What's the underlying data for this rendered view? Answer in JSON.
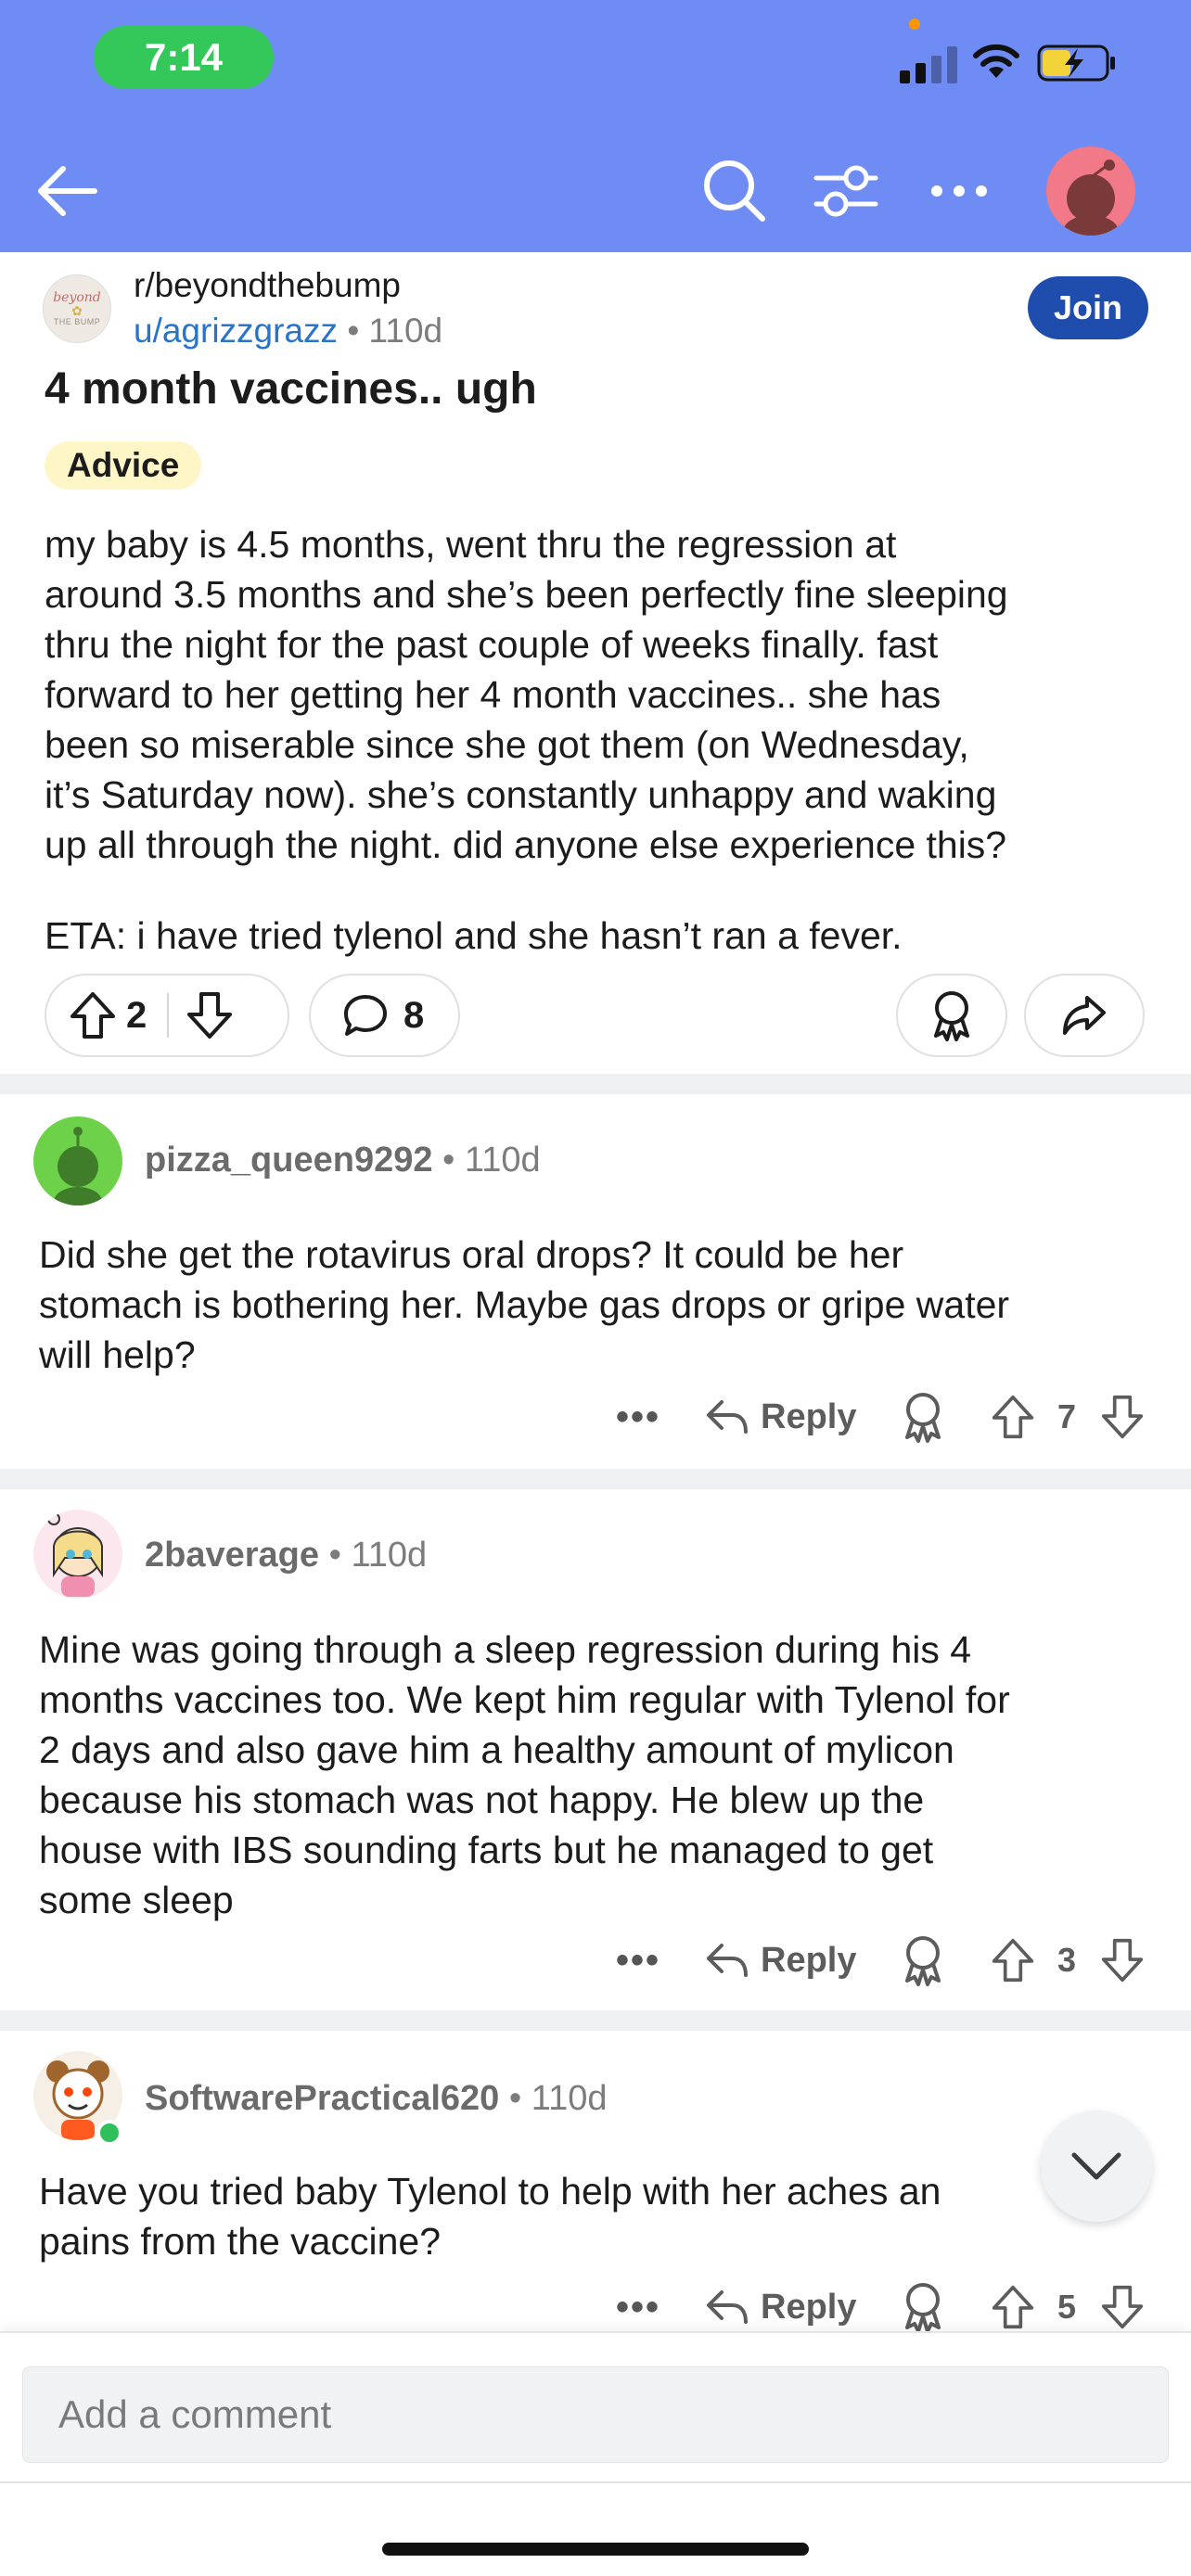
{
  "status_bar": {
    "time": "7:14",
    "icons": [
      "cellular-signal-icon",
      "wifi-icon",
      "battery-charging-icon"
    ]
  },
  "nav": {
    "icons": [
      "back-arrow-icon",
      "search-icon",
      "filter-icon",
      "more-icon",
      "profile-avatar"
    ],
    "colors": {
      "header_bg": "#6e8cf3",
      "avatar_bg": "#f27a88"
    }
  },
  "post": {
    "subreddit": "r/beyondthebump",
    "subreddit_avatar_text": {
      "line1": "beyond",
      "line2": "THE BUMP"
    },
    "author": "u/agrizzgrazz",
    "age": "110d",
    "join_label": "Join",
    "title": "4 month vaccines.. ugh",
    "flair": "Advice",
    "body_lines": [
      "my baby is 4.5 months, went thru the regression at",
      "around 3.5 months and she’s been perfectly fine sleeping",
      "thru the night for the past couple of weeks finally. fast",
      "forward to her getting her 4 month vaccines.. she has",
      "been so miserable since she got them (on Wednesday,",
      "it’s Saturday now). she’s constantly unhappy and waking",
      "up all through the night. did anyone else experience this?"
    ],
    "eta": "ETA: i have tried tylenol and she hasn’t ran a fever.",
    "upvotes": "2",
    "comments": "8"
  },
  "comments": [
    {
      "username": "pizza_queen9292",
      "age": "110d",
      "avatar_color": "#6dd24a",
      "body_lines": [
        "Did she get the rotavirus oral drops? It could be her",
        "stomach is bothering her. Maybe gas drops or gripe water",
        "will help?"
      ],
      "more": "•••",
      "reply_label": "Reply",
      "score": "7"
    },
    {
      "username": "2baverage",
      "age": "110d",
      "avatar_color": "#fde7ee",
      "body_lines": [
        "Mine was going through a sleep regression during his 4",
        "months vaccines too. We kept him regular with Tylenol for",
        "2 days and also gave him a healthy amount of mylicon",
        "because his stomach was not happy. He blew up the",
        "house with IBS sounding farts but he managed to get",
        "some sleep"
      ],
      "more": "•••",
      "reply_label": "Reply",
      "score": "3"
    },
    {
      "username": "SoftwarePractical620",
      "age": "110d",
      "avatar_color": "#f6efe6",
      "online": true,
      "body_lines": [
        "Have you tried baby Tylenol to help with her aches an",
        "pains from the vaccine?"
      ],
      "more": "•••",
      "reply_label": "Reply",
      "score": "5"
    }
  ],
  "composer": {
    "placeholder": "Add a comment"
  }
}
